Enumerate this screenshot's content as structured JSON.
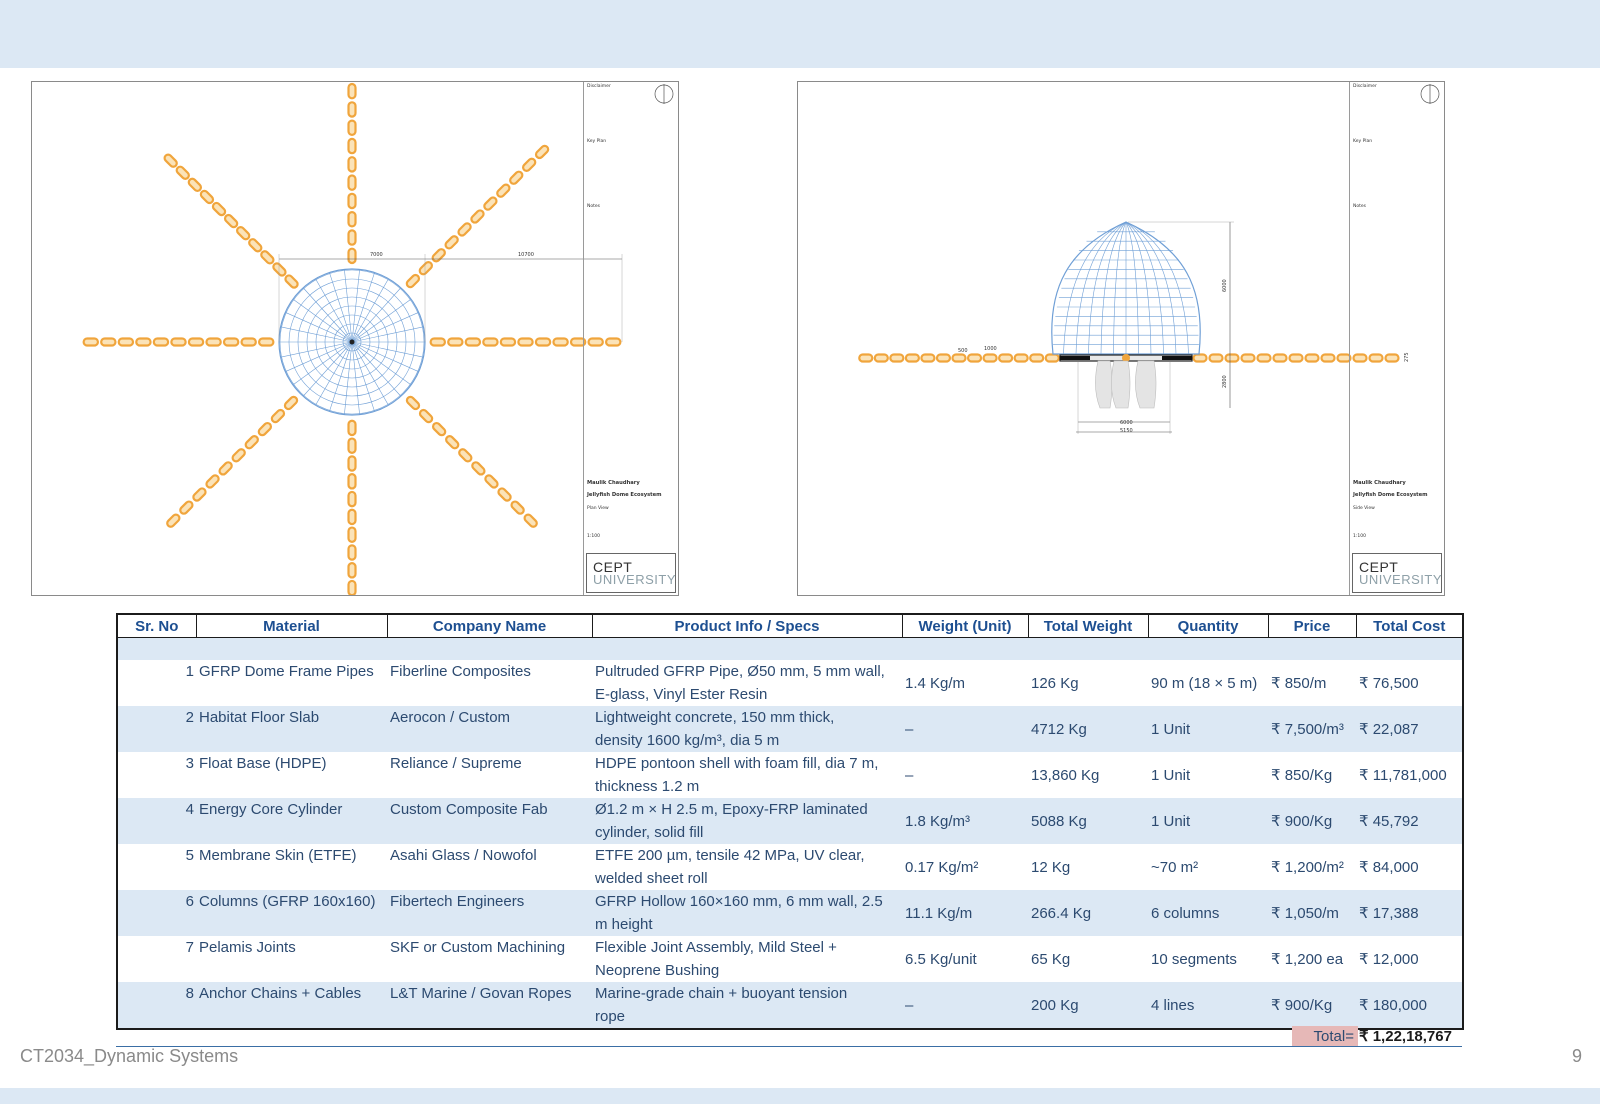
{
  "drawing_plan": {
    "title_block": {
      "disclaimer": "Disclaimer",
      "key_plan": "Key Plan",
      "notes": "Notes",
      "author": "Maulik Chaudhary",
      "project": "Jellyfish Dome Ecosystem",
      "view": "Plan View",
      "scale": "1:100",
      "logo_line1": "CEPT",
      "logo_line2": "UNIVERSITY"
    },
    "dimensions": {
      "dome_width": "7000",
      "arm_length": "10700"
    }
  },
  "drawing_side": {
    "title_block": {
      "disclaimer": "Disclaimer",
      "key_plan": "Key Plan",
      "notes": "Notes",
      "author": "Maulik Chaudhary",
      "project": "Jellyfish Dome Ecosystem",
      "view": "Side View",
      "scale": "1:100",
      "logo_line1": "CEPT",
      "logo_line2": "UNIVERSITY"
    },
    "dimensions": {
      "dome_height": "6000",
      "below_depth": "2800",
      "base_inner": "6000",
      "base_outer": "5150",
      "segment_a": "500",
      "segment_b": "1000",
      "side_offset": "275"
    }
  },
  "table": {
    "headers": [
      "Sr. No",
      "Material",
      "Company Name",
      "Product Info / Specs",
      "Weight (Unit)",
      "Total Weight",
      "Quantity",
      "Price",
      "Total Cost"
    ],
    "rows": [
      {
        "sr": "1",
        "material": "GFRP Dome Frame Pipes",
        "company": "Fiberline Composites",
        "spec1": "Pultruded GFRP Pipe, Ø50 mm, 5 mm wall,",
        "spec2": "E-glass, Vinyl Ester Resin",
        "weight_unit": "1.4 Kg/m",
        "total_weight": "126 Kg",
        "quantity": "90 m (18 × 5 m)",
        "price": "₹ 850/m",
        "total_cost": "₹ 76,500"
      },
      {
        "sr": "2",
        "material": "Habitat Floor Slab",
        "company": "Aerocon / Custom",
        "spec1": "Lightweight concrete, 150 mm thick,",
        "spec2": "density 1600 kg/m³, dia 5 m",
        "weight_unit": "–",
        "total_weight": "4712 Kg",
        "quantity": "1 Unit",
        "price": "₹ 7,500/m³",
        "total_cost": "₹ 22,087"
      },
      {
        "sr": "3",
        "material": "Float Base (HDPE)",
        "company": "Reliance / Supreme",
        "spec1": "HDPE pontoon shell with foam fill, dia 7 m,",
        "spec2": "thickness 1.2 m",
        "weight_unit": "–",
        "total_weight": "13,860 Kg",
        "quantity": "1 Unit",
        "price": "₹ 850/Kg",
        "total_cost": "₹ 11,781,000"
      },
      {
        "sr": "4",
        "material": "Energy Core Cylinder",
        "company": "Custom Composite Fab",
        "spec1": "Ø1.2 m × H 2.5 m, Epoxy-FRP laminated",
        "spec2": "cylinder, solid fill",
        "weight_unit": "1.8 Kg/m³",
        "total_weight": "5088 Kg",
        "quantity": "1 Unit",
        "price": "₹ 900/Kg",
        "total_cost": "₹ 45,792"
      },
      {
        "sr": "5",
        "material": "Membrane Skin (ETFE)",
        "company": "Asahi Glass / Nowofol",
        "spec1": "ETFE 200 µm, tensile 42 MPa, UV clear,",
        "spec2": "welded sheet roll",
        "weight_unit": "0.17 Kg/m²",
        "total_weight": "12 Kg",
        "quantity": "~70 m²",
        "price": "₹ 1,200/m²",
        "total_cost": "₹ 84,000"
      },
      {
        "sr": "6",
        "material": "Columns (GFRP 160x160)",
        "company": "Fibertech Engineers",
        "spec1": "GFRP Hollow 160×160 mm, 6 mm wall, 2.5",
        "spec2": "m height",
        "weight_unit": "11.1 Kg/m",
        "total_weight": "266.4 Kg",
        "quantity": "6 columns",
        "price": "₹ 1,050/m",
        "total_cost": "₹ 17,388"
      },
      {
        "sr": "7",
        "material": "Pelamis Joints",
        "company": "SKF or Custom Machining",
        "spec1": "Flexible Joint Assembly, Mild Steel +",
        "spec2": "Neoprene Bushing",
        "weight_unit": "6.5 Kg/unit",
        "total_weight": "65 Kg",
        "quantity": "10 segments",
        "price": "₹ 1,200 ea",
        "total_cost": "₹ 12,000"
      },
      {
        "sr": "8",
        "material": "Anchor Chains + Cables",
        "company": "L&T Marine / Govan Ropes",
        "spec1": "Marine-grade chain + buoyant tension",
        "spec2": "rope",
        "weight_unit": "–",
        "total_weight": "200 Kg",
        "quantity": "4 lines",
        "price": "₹ 900/Kg",
        "total_cost": "₹ 180,000"
      }
    ],
    "total_label": "Total=",
    "total_value": "₹ 1,22,18,767"
  },
  "footer": {
    "course": "CT2034_Dynamic Systems",
    "page": "9"
  },
  "colors": {
    "band": "#dce8f4",
    "float": "#f0a53c",
    "mesh": "#6f9fd6",
    "total_highlight": "#e6b8b7"
  }
}
